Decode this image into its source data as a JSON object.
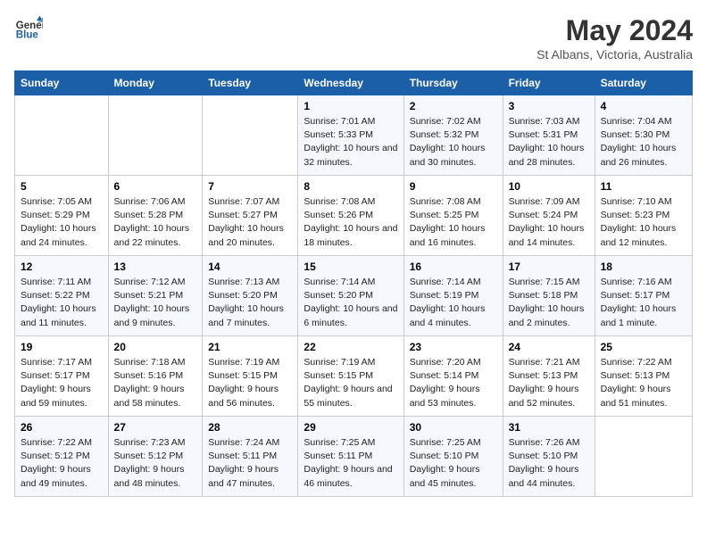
{
  "header": {
    "logo_line1": "General",
    "logo_line2": "Blue",
    "month_year": "May 2024",
    "location": "St Albans, Victoria, Australia"
  },
  "days_of_week": [
    "Sunday",
    "Monday",
    "Tuesday",
    "Wednesday",
    "Thursday",
    "Friday",
    "Saturday"
  ],
  "weeks": [
    [
      {
        "day": "",
        "sunrise": "",
        "sunset": "",
        "daylight": ""
      },
      {
        "day": "",
        "sunrise": "",
        "sunset": "",
        "daylight": ""
      },
      {
        "day": "",
        "sunrise": "",
        "sunset": "",
        "daylight": ""
      },
      {
        "day": "1",
        "sunrise": "Sunrise: 7:01 AM",
        "sunset": "Sunset: 5:33 PM",
        "daylight": "Daylight: 10 hours and 32 minutes."
      },
      {
        "day": "2",
        "sunrise": "Sunrise: 7:02 AM",
        "sunset": "Sunset: 5:32 PM",
        "daylight": "Daylight: 10 hours and 30 minutes."
      },
      {
        "day": "3",
        "sunrise": "Sunrise: 7:03 AM",
        "sunset": "Sunset: 5:31 PM",
        "daylight": "Daylight: 10 hours and 28 minutes."
      },
      {
        "day": "4",
        "sunrise": "Sunrise: 7:04 AM",
        "sunset": "Sunset: 5:30 PM",
        "daylight": "Daylight: 10 hours and 26 minutes."
      }
    ],
    [
      {
        "day": "5",
        "sunrise": "Sunrise: 7:05 AM",
        "sunset": "Sunset: 5:29 PM",
        "daylight": "Daylight: 10 hours and 24 minutes."
      },
      {
        "day": "6",
        "sunrise": "Sunrise: 7:06 AM",
        "sunset": "Sunset: 5:28 PM",
        "daylight": "Daylight: 10 hours and 22 minutes."
      },
      {
        "day": "7",
        "sunrise": "Sunrise: 7:07 AM",
        "sunset": "Sunset: 5:27 PM",
        "daylight": "Daylight: 10 hours and 20 minutes."
      },
      {
        "day": "8",
        "sunrise": "Sunrise: 7:08 AM",
        "sunset": "Sunset: 5:26 PM",
        "daylight": "Daylight: 10 hours and 18 minutes."
      },
      {
        "day": "9",
        "sunrise": "Sunrise: 7:08 AM",
        "sunset": "Sunset: 5:25 PM",
        "daylight": "Daylight: 10 hours and 16 minutes."
      },
      {
        "day": "10",
        "sunrise": "Sunrise: 7:09 AM",
        "sunset": "Sunset: 5:24 PM",
        "daylight": "Daylight: 10 hours and 14 minutes."
      },
      {
        "day": "11",
        "sunrise": "Sunrise: 7:10 AM",
        "sunset": "Sunset: 5:23 PM",
        "daylight": "Daylight: 10 hours and 12 minutes."
      }
    ],
    [
      {
        "day": "12",
        "sunrise": "Sunrise: 7:11 AM",
        "sunset": "Sunset: 5:22 PM",
        "daylight": "Daylight: 10 hours and 11 minutes."
      },
      {
        "day": "13",
        "sunrise": "Sunrise: 7:12 AM",
        "sunset": "Sunset: 5:21 PM",
        "daylight": "Daylight: 10 hours and 9 minutes."
      },
      {
        "day": "14",
        "sunrise": "Sunrise: 7:13 AM",
        "sunset": "Sunset: 5:20 PM",
        "daylight": "Daylight: 10 hours and 7 minutes."
      },
      {
        "day": "15",
        "sunrise": "Sunrise: 7:14 AM",
        "sunset": "Sunset: 5:20 PM",
        "daylight": "Daylight: 10 hours and 6 minutes."
      },
      {
        "day": "16",
        "sunrise": "Sunrise: 7:14 AM",
        "sunset": "Sunset: 5:19 PM",
        "daylight": "Daylight: 10 hours and 4 minutes."
      },
      {
        "day": "17",
        "sunrise": "Sunrise: 7:15 AM",
        "sunset": "Sunset: 5:18 PM",
        "daylight": "Daylight: 10 hours and 2 minutes."
      },
      {
        "day": "18",
        "sunrise": "Sunrise: 7:16 AM",
        "sunset": "Sunset: 5:17 PM",
        "daylight": "Daylight: 10 hours and 1 minute."
      }
    ],
    [
      {
        "day": "19",
        "sunrise": "Sunrise: 7:17 AM",
        "sunset": "Sunset: 5:17 PM",
        "daylight": "Daylight: 9 hours and 59 minutes."
      },
      {
        "day": "20",
        "sunrise": "Sunrise: 7:18 AM",
        "sunset": "Sunset: 5:16 PM",
        "daylight": "Daylight: 9 hours and 58 minutes."
      },
      {
        "day": "21",
        "sunrise": "Sunrise: 7:19 AM",
        "sunset": "Sunset: 5:15 PM",
        "daylight": "Daylight: 9 hours and 56 minutes."
      },
      {
        "day": "22",
        "sunrise": "Sunrise: 7:19 AM",
        "sunset": "Sunset: 5:15 PM",
        "daylight": "Daylight: 9 hours and 55 minutes."
      },
      {
        "day": "23",
        "sunrise": "Sunrise: 7:20 AM",
        "sunset": "Sunset: 5:14 PM",
        "daylight": "Daylight: 9 hours and 53 minutes."
      },
      {
        "day": "24",
        "sunrise": "Sunrise: 7:21 AM",
        "sunset": "Sunset: 5:13 PM",
        "daylight": "Daylight: 9 hours and 52 minutes."
      },
      {
        "day": "25",
        "sunrise": "Sunrise: 7:22 AM",
        "sunset": "Sunset: 5:13 PM",
        "daylight": "Daylight: 9 hours and 51 minutes."
      }
    ],
    [
      {
        "day": "26",
        "sunrise": "Sunrise: 7:22 AM",
        "sunset": "Sunset: 5:12 PM",
        "daylight": "Daylight: 9 hours and 49 minutes."
      },
      {
        "day": "27",
        "sunrise": "Sunrise: 7:23 AM",
        "sunset": "Sunset: 5:12 PM",
        "daylight": "Daylight: 9 hours and 48 minutes."
      },
      {
        "day": "28",
        "sunrise": "Sunrise: 7:24 AM",
        "sunset": "Sunset: 5:11 PM",
        "daylight": "Daylight: 9 hours and 47 minutes."
      },
      {
        "day": "29",
        "sunrise": "Sunrise: 7:25 AM",
        "sunset": "Sunset: 5:11 PM",
        "daylight": "Daylight: 9 hours and 46 minutes."
      },
      {
        "day": "30",
        "sunrise": "Sunrise: 7:25 AM",
        "sunset": "Sunset: 5:10 PM",
        "daylight": "Daylight: 9 hours and 45 minutes."
      },
      {
        "day": "31",
        "sunrise": "Sunrise: 7:26 AM",
        "sunset": "Sunset: 5:10 PM",
        "daylight": "Daylight: 9 hours and 44 minutes."
      },
      {
        "day": "",
        "sunrise": "",
        "sunset": "",
        "daylight": ""
      }
    ]
  ]
}
